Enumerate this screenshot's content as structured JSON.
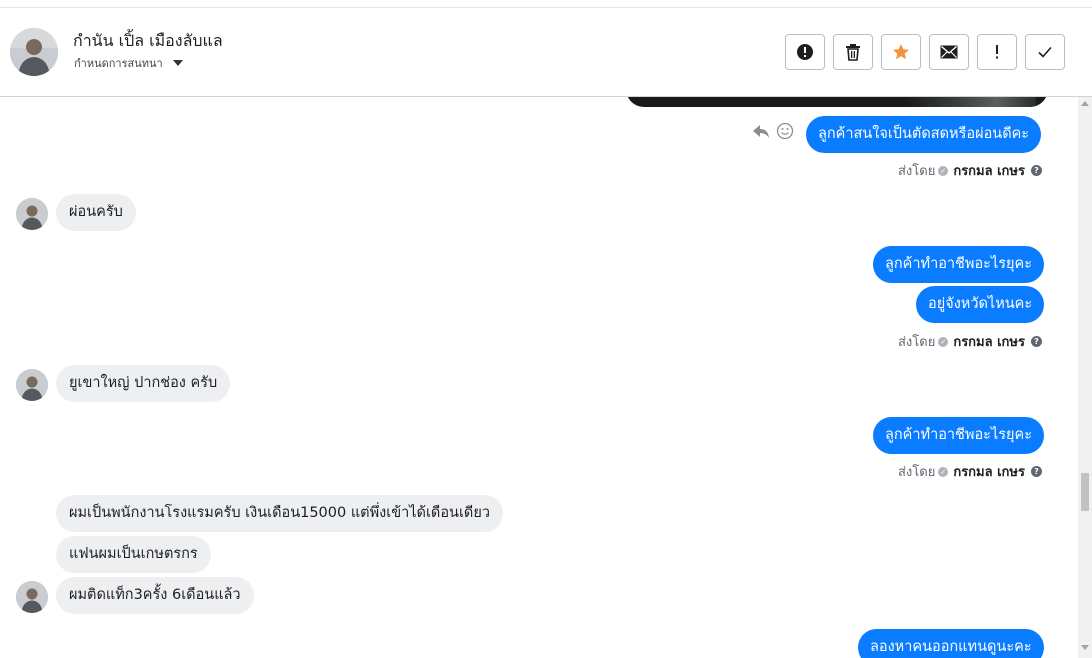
{
  "header": {
    "contact_name": "กำนัน เปิ้ล เมืองลับแล",
    "assign_label": "กำหนดการสนทนา",
    "actions": [
      {
        "name": "report-spam-button",
        "icon": "alert-circle-icon"
      },
      {
        "name": "delete-button",
        "icon": "trash-icon"
      },
      {
        "name": "star-button",
        "icon": "star-icon"
      },
      {
        "name": "mark-unread-button",
        "icon": "envelope-icon"
      },
      {
        "name": "mark-important-button",
        "icon": "exclamation-icon"
      },
      {
        "name": "mark-done-button",
        "icon": "check-icon"
      }
    ],
    "accent_star": "#f5923e"
  },
  "thread": {
    "outgoing_color": "#0a7cff",
    "incoming_color": "#eeeff1",
    "sent_by_label": "ส่งโดย",
    "agent_name": "กรกมล เกษร",
    "messages": {
      "m1": "ลูกค้าสนใจเป็นตัดสดหรือผ่อนดีคะ",
      "m2": "ผ่อนครับ",
      "m3": "ลูกค้าทำอาชีพอะไรยุคะ",
      "m4": "อยู่จังหวัดไหนคะ",
      "m5": "ยูเขาใหญ่  ปากช่อง  ครับ",
      "m6": "ลูกค้าทำอาชีพอะไรยุคะ",
      "m7": "ผมเป็นพนักงานโรงแรมครับ  เงินเดือน15000  แต่พึ่งเข้าได้เดือนเดียว",
      "m8": "แฟนผมเป็นเกษตรกร",
      "m9": "ผมติดแท็ก3ครั้ง  6เดือนแล้ว",
      "m10": "ลองหาคนออกแทนดูนะคะ"
    }
  }
}
